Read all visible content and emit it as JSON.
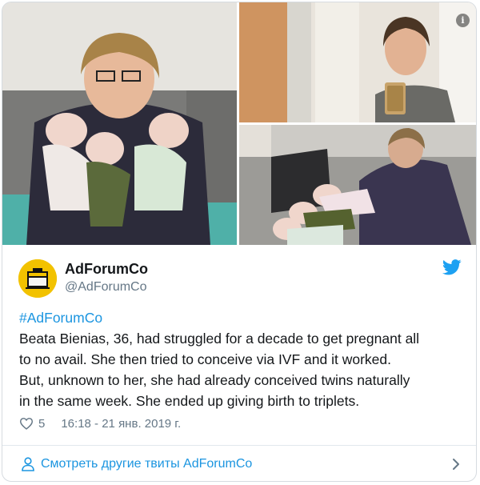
{
  "tweet": {
    "display_name": "AdForumCo",
    "handle": "@AdForumCo",
    "hashtag": "#AdForumCo",
    "text_lines": [
      "Beata Bienias, 36, had struggled for a decade to get pregnant all",
      "to no avail. She then tried to conceive via IVF and it worked.",
      "But, unknown to her, she had already conceived twins naturally",
      "in the same week. She ended up giving birth to triplets."
    ],
    "likes": "5",
    "timestamp": "16:18 - 21 янв. 2019 г.",
    "footer_link": "Смотреть другие твиты AdForumCo"
  },
  "media": {
    "info_glyph": "i",
    "images": [
      {
        "name": "mother-holding-triplets-photo"
      },
      {
        "name": "mirror-selfie-photo"
      },
      {
        "name": "mother-with-babies-on-sofa-photo"
      }
    ]
  },
  "icons": {
    "brand": "twitter-bird-icon",
    "like": "heart-icon",
    "profile": "user-icon",
    "more": "chevron-right-icon",
    "info": "info-icon"
  },
  "colors": {
    "accent": "#1b95e0",
    "text": "#14171a",
    "muted": "#657786",
    "avatar_bg": "#f2c200",
    "border": "#d6dbe0"
  }
}
